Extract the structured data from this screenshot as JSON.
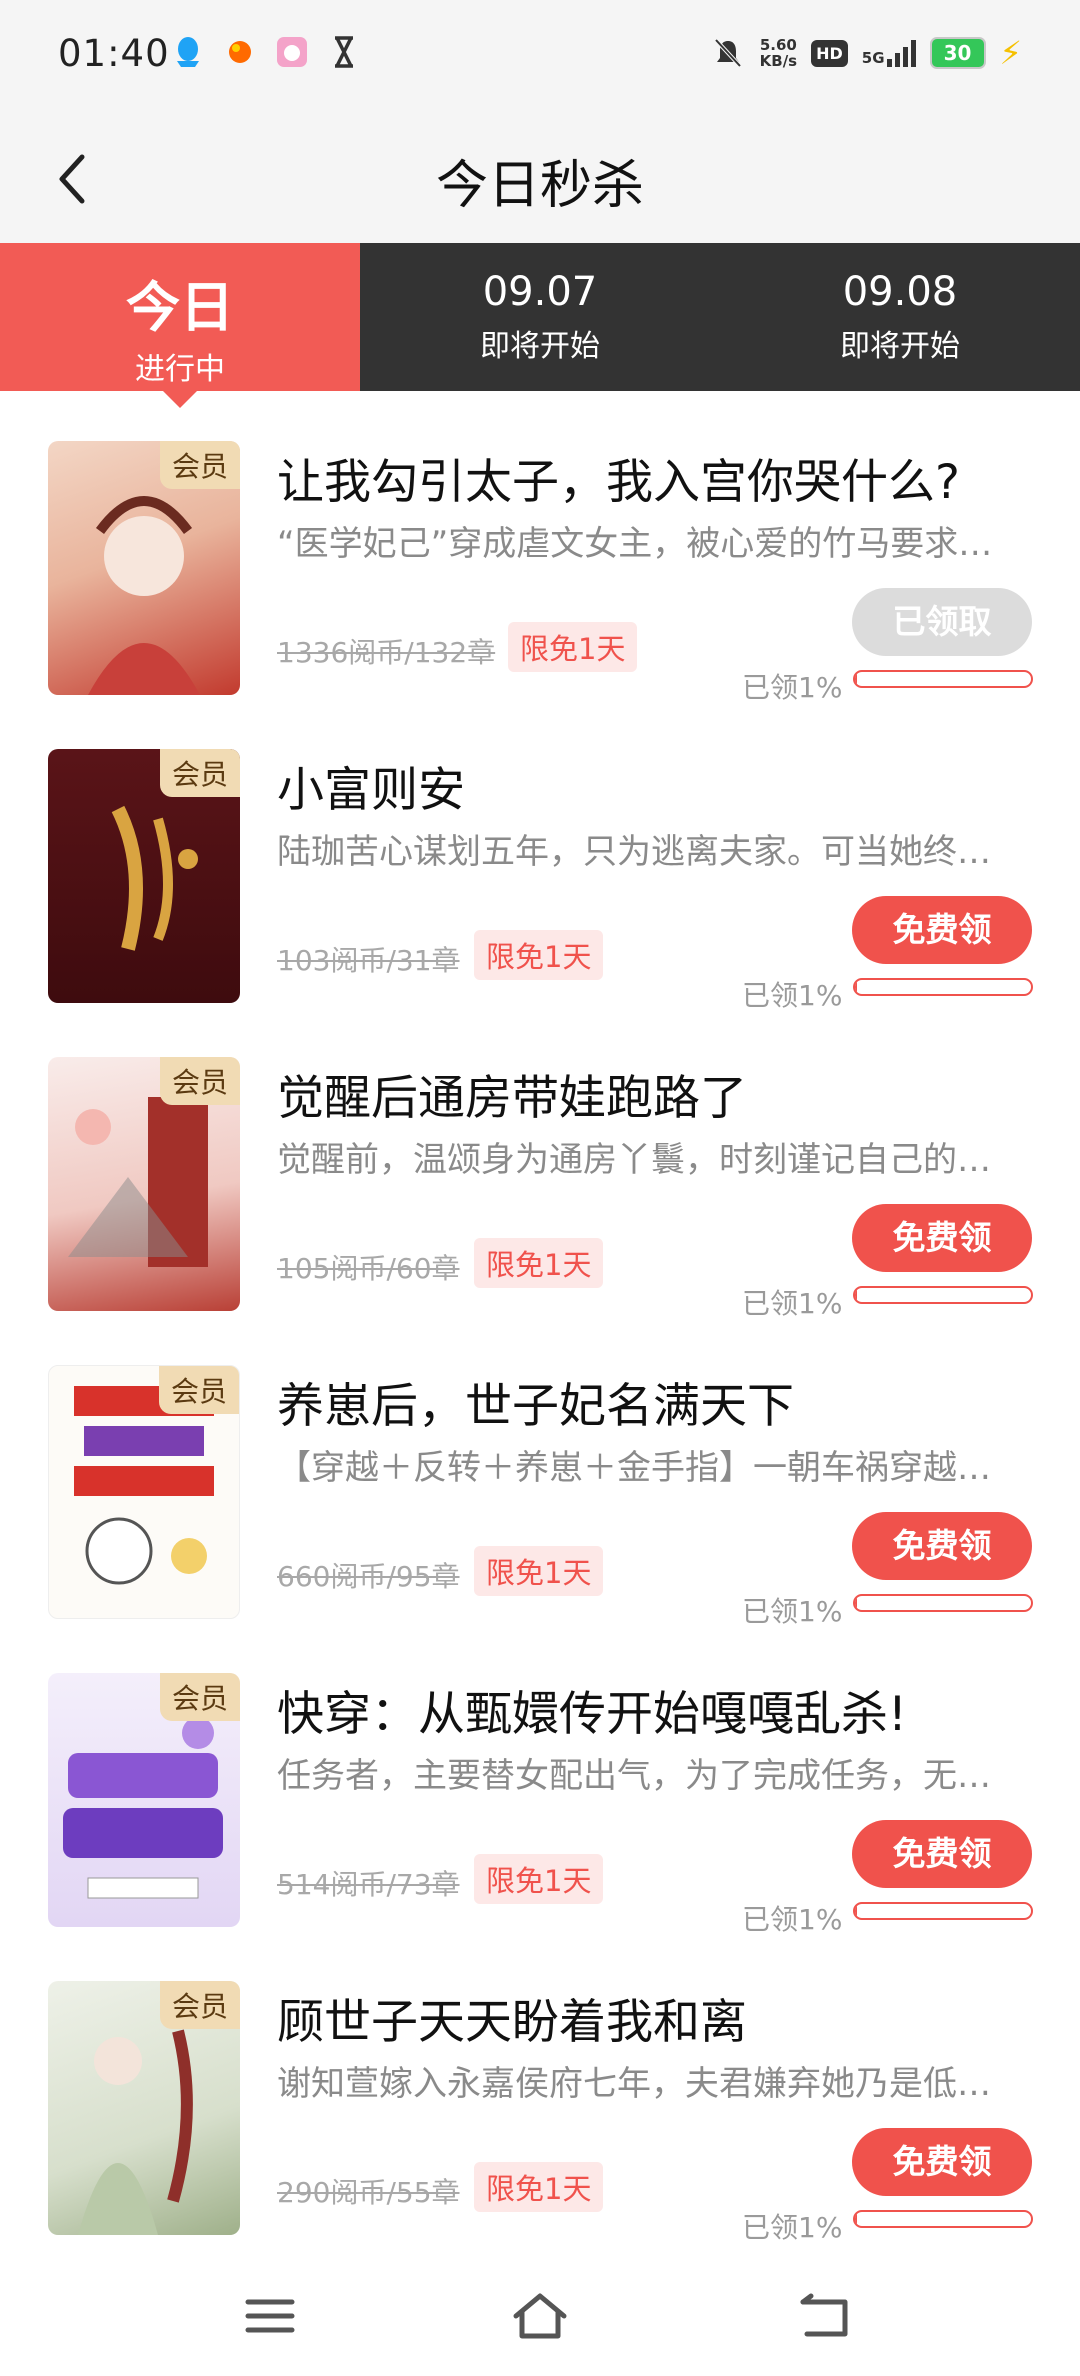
{
  "status_bar": {
    "time": "01:40",
    "speed_value": "5.60",
    "speed_unit": "KB/s",
    "hd": "HD",
    "network": "5G",
    "battery": "30"
  },
  "header": {
    "title": "今日秒杀"
  },
  "tabs": [
    {
      "main": "今日",
      "sub": "进行中",
      "active": true
    },
    {
      "main": "09.07",
      "sub": "即将开始",
      "active": false
    },
    {
      "main": "09.08",
      "sub": "即将开始",
      "active": false
    }
  ],
  "books": [
    {
      "badge": "会员",
      "title": "让我勾引太子，我入宫你哭什么?",
      "desc": "“医学妃己”穿成虐文女主，被心爱的竹马要求…",
      "price": "1336阅币/132章",
      "free_tag": "限免1天",
      "button": "已领取",
      "claimed_button": true,
      "claimed": "已领1%",
      "progress": 0.01,
      "cover_colors": [
        "#f3d6c5",
        "#c23a2e"
      ]
    },
    {
      "badge": "会员",
      "title": "小富则安",
      "desc": "陆珈苦心谋划五年，只为逃离夫家。可当她终…",
      "price": "103阅币/31章",
      "free_tag": "限免1天",
      "button": "免费领",
      "claimed_button": false,
      "claimed": "已领1%",
      "progress": 0.01,
      "cover_colors": [
        "#4a0f12",
        "#d9a441"
      ]
    },
    {
      "badge": "会员",
      "title": "觉醒后通房带娃跑路了",
      "desc": "觉醒前，温颂身为通房丫鬟，时刻谨记自己的…",
      "price": "105阅币/60章",
      "free_tag": "限免1天",
      "button": "免费领",
      "claimed_button": false,
      "claimed": "已领1%",
      "progress": 0.01,
      "cover_colors": [
        "#f6e2de",
        "#a3302a"
      ]
    },
    {
      "badge": "会员",
      "title": "养崽后，世子妃名满天下",
      "desc": "【穿越＋反转＋养崽＋金手指】一朝车祸穿越…",
      "price": "660阅币/95章",
      "free_tag": "限免1天",
      "button": "免费领",
      "claimed_button": false,
      "claimed": "已领1%",
      "progress": 0.01,
      "cover_colors": [
        "#fdfbf7",
        "#d8322b"
      ]
    },
    {
      "badge": "会员",
      "title": "快穿：从甄嬛传开始嘎嘎乱杀!",
      "desc": "任务者，主要替女配出气，为了完成任务，无…",
      "price": "514阅币/73章",
      "free_tag": "限免1天",
      "button": "免费领",
      "claimed_button": false,
      "claimed": "已领1%",
      "progress": 0.01,
      "cover_colors": [
        "#ece4f6",
        "#7c4fc4"
      ]
    },
    {
      "badge": "会员",
      "title": "顾世子天天盼着我和离",
      "desc": "谢知萱嫁入永嘉侯府七年，夫君嫌弃她乃是低…",
      "price": "290阅币/55章",
      "free_tag": "限免1天",
      "button": "免费领",
      "claimed_button": false,
      "claimed": "已领1%",
      "progress": 0.01,
      "cover_colors": [
        "#e7ece0",
        "#8e2f2a"
      ]
    }
  ],
  "colors": {
    "accent": "#f0524c",
    "tab_active": "#f25b55",
    "tab_bg": "#333333",
    "badge_bg": "#f1dbb4"
  },
  "icons": [
    "back-icon",
    "qq-icon",
    "orange-dot-icon",
    "app-icon",
    "hourglass-icon",
    "mute-bell-icon",
    "signal-icon",
    "charging-icon",
    "menu-icon",
    "home-icon",
    "return-icon"
  ]
}
